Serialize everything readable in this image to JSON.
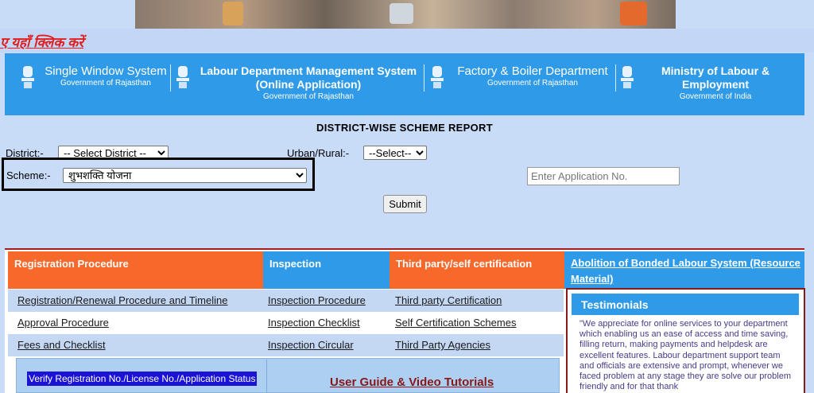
{
  "click_hindi": "ए यहाँ क्लिक करें",
  "header": {
    "items": [
      {
        "title": "Single Window System",
        "subtitle": "Government of Rajasthan"
      },
      {
        "title": "Labour Department Management System (Online Application)",
        "subtitle": "Government of Rajasthan"
      },
      {
        "title": "Factory & Boiler Department",
        "subtitle": "Government of Rajasthan"
      },
      {
        "title": "Ministry of Labour & Employment",
        "subtitle": "Government of India"
      }
    ]
  },
  "report": {
    "title": "DISTRICT-WISE SCHEME REPORT",
    "district_label": "District:-",
    "district_value": "-- Select District --",
    "urban_label": "Urban/Rural:-",
    "urban_value": "--Select--",
    "scheme_label": "Scheme:-",
    "scheme_value": "शुभशक्ति योजना",
    "appno_placeholder": "Enter Application No.",
    "submit_label": "Submit"
  },
  "columns": {
    "registration": "Registration Procedure",
    "inspection": "Inspection",
    "third_party": "Third party/self certification",
    "abolition": "Abolition of Bonded Labour System (Resource Material)"
  },
  "rows": [
    {
      "c1": "Registration/Renewal Procedure and Timeline",
      "c2": "Inspection Procedure",
      "c3": "Third party Certification"
    },
    {
      "c1": "Approval Procedure",
      "c2": "Inspection Checklist",
      "c3": "Self Certification Schemes"
    },
    {
      "c1": "Fees and Checklist",
      "c2": "Inspection Circular",
      "c3": "Third Party Agencies"
    }
  ],
  "verify_label": "Verify Registration No./License No./Application Status",
  "guide_label": "User Guide & Video Tutorials",
  "testimonials": {
    "heading": "Testimonials",
    "text": "\"We appreciate for online services to your department which enabling us an ease of access and time saving, filling return, making payments and helpdesk are excellent features. Labour department support team and officials are extensive and prompt, whenever we faced problem at any stage they are solve our problem friendly and for that thank"
  }
}
